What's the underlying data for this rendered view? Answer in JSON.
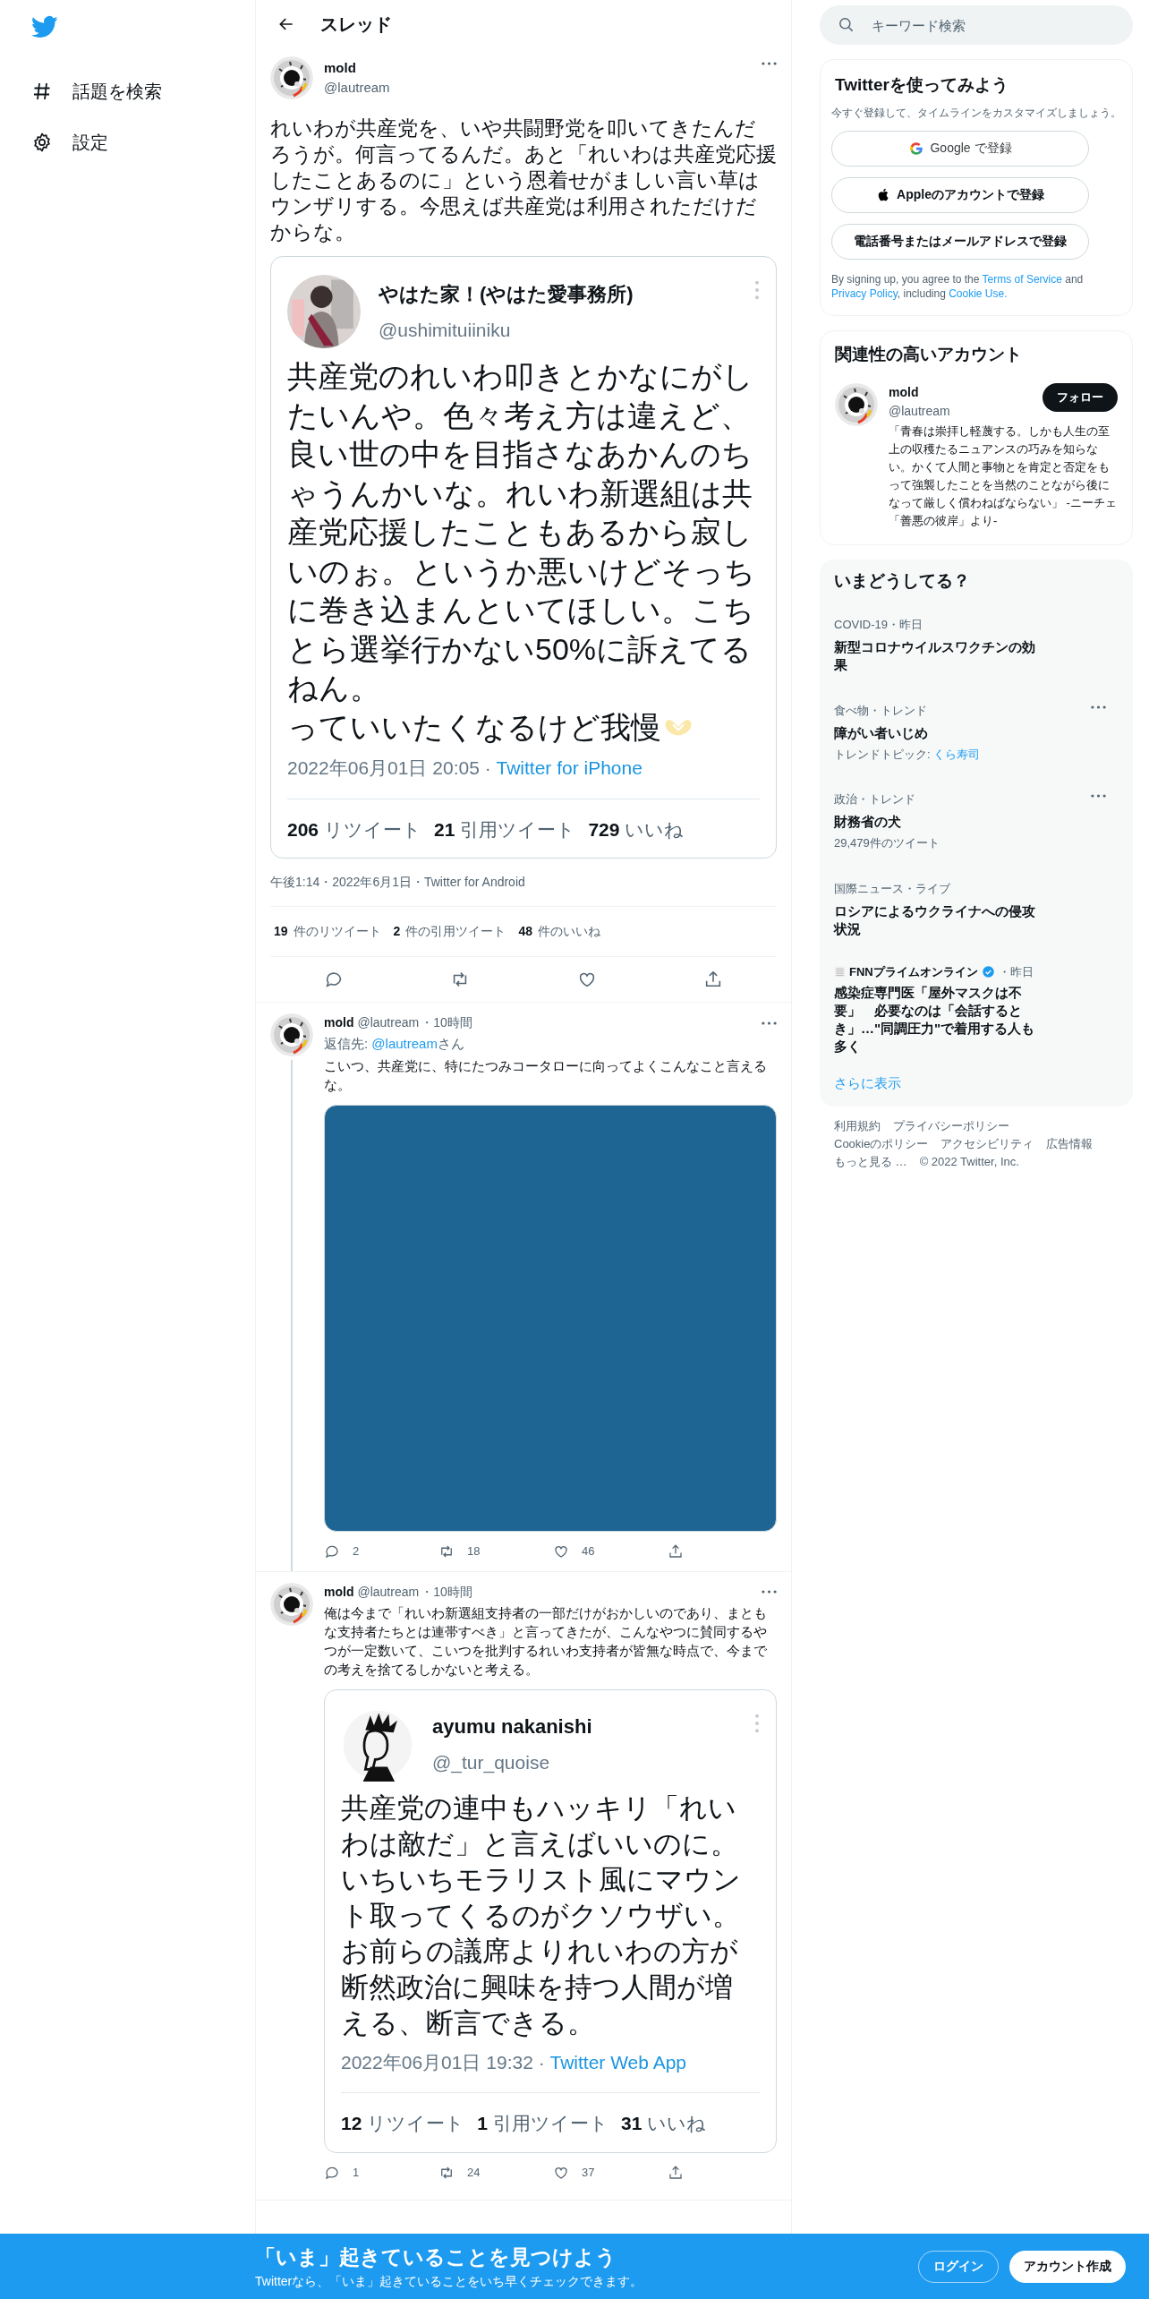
{
  "sidebar": {
    "items": [
      {
        "kind": "hash",
        "label": "話題を検索"
      },
      {
        "kind": "gear",
        "label": "設定"
      }
    ]
  },
  "header": {
    "title": "スレッド"
  },
  "main_tweet": {
    "name": "mold",
    "handle": "@lautream",
    "text": "れいわが共産党を、いや共闘野党を叩いてきたんだろうが。何言ってるんだ。あと「れいわは共産党応援したことあるのに」という恩着せがましい言い草はウンザリする。今思えば共産党は利用されただけだからな。",
    "quoted": {
      "name": "やはた家！(やはた愛事務所)",
      "handle": "@ushimituiiniku",
      "paragraphs": [
        "共産党のれいわ叩きとかなにがしたいんや。色々考え方は違えど、良い世の中を目指さなあかんのちゃうんかいな。れいわ新選組は共産党応援したこともあるから寂しいのぉ。というか悪いけどそっちに巻き込まんといてほしい。こちとら選挙行かない50%に訴えてるねん。",
        "っていいたくなるけど我慢"
      ],
      "emoji": true,
      "date": "2022年06月01日 20:05 ·",
      "source": "Twitter for iPhone",
      "stats": [
        {
          "count": "206",
          "label": "リツイート"
        },
        {
          "count": "21",
          "label": "引用ツイート"
        },
        {
          "count": "729",
          "label": "いいね"
        }
      ]
    },
    "meta": "午後1:14・2022年6月1日・Twitter for Android",
    "stats": [
      {
        "count": "19",
        "label": "件のリツイート"
      },
      {
        "count": "2",
        "label": "件の引用ツイート"
      },
      {
        "count": "48",
        "label": "件のいいね"
      }
    ]
  },
  "replies": [
    {
      "name": "mold",
      "handle": "@lautream",
      "time": "・10時間",
      "reply_prefix": "返信先: ",
      "reply_to": "@lautream",
      "reply_suffix": "さん",
      "text": "こいつ、共産党に、特にたつみコータローに向ってよくこんなこと言えるな。",
      "thread_line": true,
      "counts": [
        "2",
        "18",
        "46"
      ]
    },
    {
      "name": "mold",
      "handle": "@lautream",
      "time": "・10時間",
      "text": "俺は今まで「れいわ新選組支持者の一部だけがおかしいのであり、まともな支持者たちとは連帯すべき」と言ってきたが、こんなやつに賛同するやつが一定数いて、こいつを批判するれいわ支持者が皆無な時点で、今までの考えを捨てるしかないと考える。",
      "media": {
        "kind": "screenshot",
        "name": "ayumu nakanishi",
        "handle": "@_tur_quoise",
        "paragraphs": [
          "共産党の連中もハッキリ「れいわは敵だ」と言えばいいのに。いちいちモラリスト風にマウント取ってくるのがクソウザい。お前らの議席よりれいわの方が断然政治に興味を持つ人間が増える、断言できる。"
        ],
        "date": "2022年06月01日 19:32 ·",
        "source": "Twitter Web App",
        "stats": [
          {
            "count": "12",
            "label": "リツイート"
          },
          {
            "count": "1",
            "label": "引用ツイート"
          },
          {
            "count": "31",
            "label": "いいね"
          }
        ]
      },
      "thread_line": false,
      "counts": [
        "1",
        "24",
        "37"
      ]
    }
  ],
  "search": {
    "placeholder": "キーワード検索"
  },
  "signup": {
    "title": "Twitterを使ってみよう",
    "subtitle": "今すぐ登録して、タイムラインをカスタマイズしましょう。",
    "buttons": [
      {
        "kind": "google",
        "label": "Google で登録"
      },
      {
        "kind": "apple",
        "label": "Appleのアカウントで登録"
      },
      {
        "kind": "plain",
        "label": "電話番号またはメールアドレスで登録"
      }
    ],
    "legal": [
      {
        "kind": "text",
        "text": "By signing up, you agree to the "
      },
      {
        "kind": "link",
        "text": "Terms of Service"
      },
      {
        "kind": "text",
        "text": " and "
      },
      {
        "kind": "link",
        "text": "Privacy Policy"
      },
      {
        "kind": "text",
        "text": ", including "
      },
      {
        "kind": "link",
        "text": "Cookie Use."
      }
    ]
  },
  "who_to_follow": {
    "title": "関連性の高いアカウント",
    "accounts": [
      {
        "name": "mold",
        "handle": "@lautream",
        "bio": "「青春は崇拝し軽蔑する。しかも人生の至上の収穫たるニュアンスの巧みを知らない。かくて人間と事物とを肯定と否定をもって強襲したことを当然のことながら後になって厳しく償わねばならない」 -ニーチェ「善悪の彼岸」より-",
        "button": "フォロー"
      }
    ]
  },
  "trends": {
    "title": "いまどうしてる？",
    "items": [
      {
        "kind": "trend",
        "context": "COVID-19・昨日",
        "title": "新型コロナウイルスワクチンの効果",
        "menu": false
      },
      {
        "kind": "trend",
        "context": "食べ物・トレンド",
        "title": "障がい者いじめ",
        "sub": "トレンドトピック: ",
        "sub_link": "くら寿司",
        "menu": true
      },
      {
        "kind": "trend",
        "context": "政治・トレンド",
        "title": "財務省の犬",
        "sub": "29,479件のツイート",
        "menu": true
      },
      {
        "kind": "trend",
        "context": "国際ニュース・ライブ",
        "title": "ロシアによるウクライナへの侵攻状況",
        "menu": false
      },
      {
        "kind": "news",
        "source": "FNNプライムオンライン",
        "verified": true,
        "time": "・昨日",
        "title": "感染症専門医「屋外マスクは不要」　必要なのは「会話するとき」…\"同調圧力\"で着用する人も多く",
        "menu": false
      }
    ],
    "more": "さらに表示"
  },
  "footer": {
    "lines": [
      [
        "利用規約",
        "プライバシーポリシー"
      ],
      [
        "Cookieのポリシー",
        "アクセシビリティ",
        "広告情報"
      ],
      [
        "もっと見る …",
        "© 2022 Twitter, Inc."
      ]
    ]
  },
  "banner": {
    "title": "「いま」起きていることを見つけよう",
    "subtitle": "Twitterなら、「いま」起きていることをいち早くチェックできます。",
    "buttons": [
      {
        "kind": "outline",
        "label": "ログイン"
      },
      {
        "kind": "solid",
        "label": "アカウント作成"
      }
    ]
  }
}
